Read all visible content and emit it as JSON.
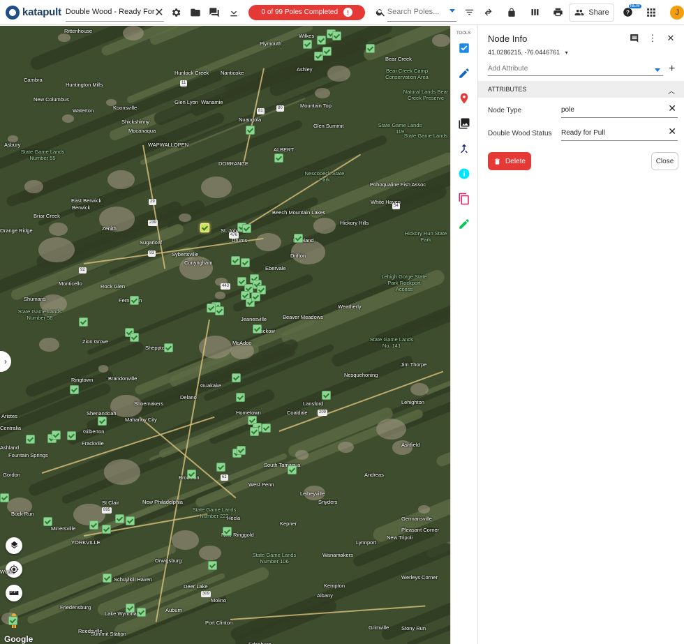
{
  "header": {
    "logo_text": "katapult",
    "job_name": "Double Wood - Ready For Pull",
    "progress_label": "0 of 99 Poles Completed",
    "progress_info": "!",
    "search_placeholder": "Search Poles...",
    "share_label": "Share",
    "new_badge": "NEW",
    "avatar_initial": "J",
    "progress_color": "#e53935"
  },
  "map": {
    "attribution": "Google",
    "labels": [
      "Rittenhouse",
      "Plymouth",
      "Wilkes",
      "Bear Creek",
      "Bear Creek Camp Conservation Area",
      "Cambra",
      "Huntington Mills",
      "Hunlock Creek",
      "Nanticoke",
      "Ashley",
      "Natural Lands Bear Creek Preserve",
      "New Columbus",
      "Waterton",
      "Koonsville",
      "Glen Lyon",
      "Wanamie",
      "Mountain Top",
      "Shickshinny",
      "Mocanaqua",
      "Nuangola",
      "Glen Summit",
      "State Game Lands 119",
      "Asbury",
      "State Game Lands Number 55",
      "WAPWALLOPEN",
      "ALBERT",
      "State Game Lands",
      "DORRANCE",
      "Nescopeck State Park",
      "Pohoqualine Fish Assoc",
      "East Berwick",
      "Berwick",
      "Briar Creek",
      "Beech Mountain Lakes",
      "White Haven",
      "Zenith",
      "Hickory Hills",
      "Hickory Run State Park",
      "Orange Ridge",
      "Sugarloaf",
      "St. Johns",
      "Drums",
      "Freeland",
      "Drifton",
      "Sybertsville",
      "Conyngham",
      "Ebervale",
      "Monticello",
      "Rock Glen",
      "Lehigh Gorge State Park Rockport Access",
      "Shumans",
      "Fern Glen",
      "Weatherly",
      "State Game Lands Number 58",
      "Jeanesville",
      "Beaver Meadows",
      "Tresckow",
      "Zion Grove",
      "Sheppton",
      "McAdoo",
      "State Game Lands No. 141",
      "Jim Thorpe",
      "Brandonville",
      "Ringtown",
      "Nesquehoning",
      "Guakake",
      "Delano",
      "Shoemakers",
      "Hometown",
      "Lansford",
      "Lehighton",
      "Shenandoah",
      "Mahanoy City",
      "Coaldale",
      "Aristes",
      "Centralia",
      "Gilberton",
      "Ashland",
      "Frackville",
      "Fountain Springs",
      "Ashfield",
      "Gordon",
      "Brockton",
      "South Tamaqua",
      "Andreas",
      "West Penn",
      "Buck Run",
      "St Clair",
      "New Philadelphia",
      "Leibeyville",
      "Snyders",
      "Germansville",
      "Minersville",
      "YORKVILLE",
      "State Game Lands Number 222",
      "Hecla",
      "Kepner",
      "Lynnport",
      "New Tripoli",
      "Pleasant Corner",
      "New Ringgold",
      "Orwigsburg",
      "Wanamakers",
      "State Game Lands Number 106",
      "Wood",
      "Schuylkill Haven",
      "Deer Lake",
      "Kempton",
      "Werleys Corner",
      "Friedensburg",
      "Albany",
      "Molino",
      "Lake Wynonah",
      "Auburn",
      "Port Clinton",
      "Reedsville",
      "Summit Station",
      "Grimville",
      "Stony Run",
      "Edenburg"
    ],
    "route_numbers": [
      "11",
      "29",
      "239",
      "93",
      "92",
      "81",
      "80",
      "476",
      "54",
      "209",
      "61",
      "895",
      "309",
      "443"
    ],
    "pole_count": 99,
    "pole_color": "#8fd694",
    "selected_pole_color": "#d4e157"
  },
  "tools": {
    "label": "TOOLS",
    "items": [
      {
        "name": "checklist-tool-icon",
        "color": "#1e88e5"
      },
      {
        "name": "pencil-tool-icon",
        "color": "#1565c0"
      },
      {
        "name": "location-pin-tool-icon",
        "color": "#e53935"
      },
      {
        "name": "photos-tool-icon",
        "color": "#212121"
      },
      {
        "name": "merge-tool-icon",
        "color": "#1a237e"
      },
      {
        "name": "info-tool-icon",
        "color": "#00e5ff"
      },
      {
        "name": "copy-tool-icon",
        "color": "#e91e63"
      },
      {
        "name": "edit-green-tool-icon",
        "color": "#00c853"
      }
    ]
  },
  "panel": {
    "title": "Node Info",
    "coordinates": "41.0286215, -76.0446761",
    "add_attribute_placeholder": "Add Attribute",
    "section_title": "ATTRIBUTES",
    "attributes": [
      {
        "key": "Node Type",
        "value": "pole"
      },
      {
        "key": "Double Wood Status",
        "value": "Ready for Pull"
      }
    ],
    "delete_label": "Delete",
    "close_label": "Close",
    "delete_color": "#e53935"
  }
}
